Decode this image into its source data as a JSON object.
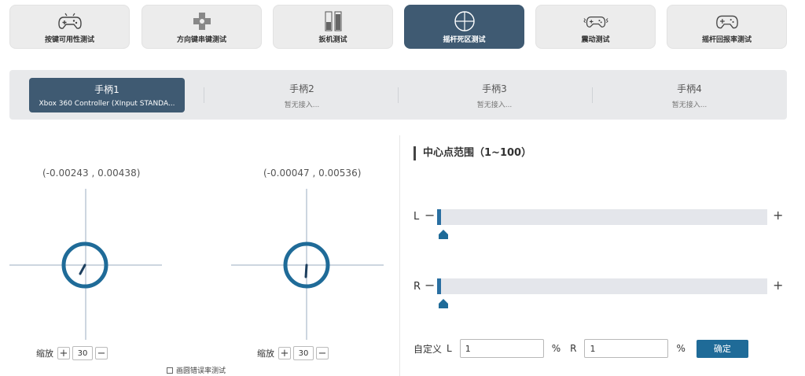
{
  "tabs": [
    {
      "label": "按键可用性测试",
      "icon": "gamepad-icon",
      "active": false
    },
    {
      "label": "方向键串键测试",
      "icon": "dpad-icon",
      "active": false
    },
    {
      "label": "扳机测试",
      "icon": "trigger-icon",
      "active": false
    },
    {
      "label": "摇杆死区测试",
      "icon": "crosshair-icon",
      "active": true
    },
    {
      "label": "震动测试",
      "icon": "vibrating-gamepad-icon",
      "active": false
    },
    {
      "label": "摇杆回报率测试",
      "icon": "gamepad-outline-icon",
      "active": false
    }
  ],
  "controllers": [
    {
      "name": "手柄1",
      "status": "Xbox 360 Controller (XInput STANDA...",
      "active": true
    },
    {
      "name": "手柄2",
      "status": "暂无接入...",
      "active": false
    },
    {
      "name": "手柄3",
      "status": "暂无接入...",
      "active": false
    },
    {
      "name": "手柄4",
      "status": "暂无接入...",
      "active": false
    }
  ],
  "sticks": {
    "left": {
      "coord": "(-0.00243 , 0.00438)",
      "zoom_label": "缩放",
      "zoom_value": "30"
    },
    "right": {
      "coord": "(-0.00047 , 0.00536)",
      "zoom_label": "缩放",
      "zoom_value": "30"
    }
  },
  "circle_test_label": "画圆错误率测试",
  "deadzone": {
    "title": "中心点范围（1~100）",
    "left": {
      "label": "L",
      "minus": "−",
      "plus": "+",
      "value": 1
    },
    "right": {
      "label": "R",
      "minus": "−",
      "plus": "+",
      "value": 1
    }
  },
  "custom": {
    "label": "自定义",
    "l_label": "L",
    "l_value": "1",
    "percent": "%",
    "r_label": "R",
    "r_value": "1",
    "confirm": "确定"
  },
  "colors": {
    "active_tab": "#3f5a72",
    "stick_ring": "#1f6b98",
    "slider_fill": "#2a6fa1",
    "confirm_button": "#1f6b98"
  }
}
